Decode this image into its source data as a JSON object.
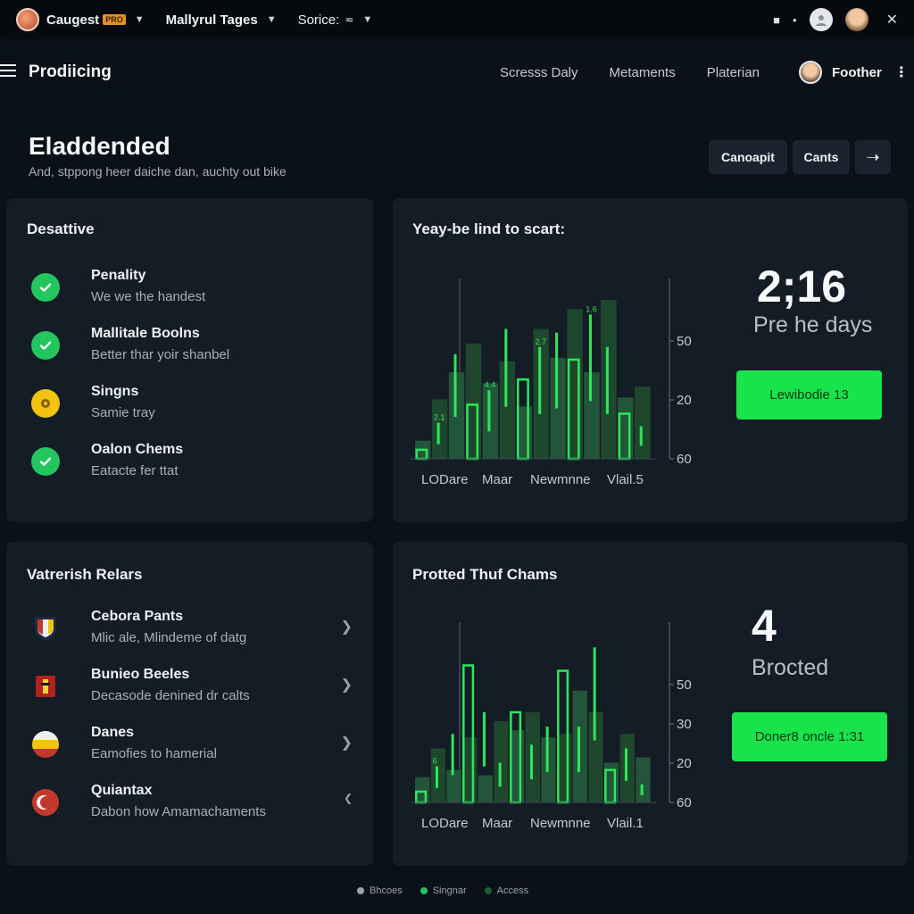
{
  "topbar": {
    "app_name": "Caugest",
    "app_badge": "PRO",
    "menu2": "Mallyrul Tages",
    "menu3": "Sorice:",
    "menu3_value": "≂"
  },
  "nav": {
    "title": "Prodiicing",
    "links": [
      "Scresss Daly",
      "Metaments",
      "Platerian"
    ],
    "user_name": "Foother"
  },
  "header": {
    "title": "Eladdended",
    "subtitle": "And, stppong heer daiche dan, auchty out bike",
    "actions": [
      "Canoapit",
      "Cants"
    ]
  },
  "status_card": {
    "title": "Desattive",
    "items": [
      {
        "title": "Penality",
        "subtitle": "We we the handest",
        "status": "check"
      },
      {
        "title": "Mallitale Boolns",
        "subtitle": "Better thar yoir shanbel",
        "status": "check"
      },
      {
        "title": "Singns",
        "subtitle": "Samie tray",
        "status": "warning"
      },
      {
        "title": "Oalon Chems",
        "subtitle": "Eatacte fer ttat",
        "status": "check"
      }
    ]
  },
  "relations_card": {
    "title": "Vatrerish Relars",
    "items": [
      {
        "title": "Cebora Pants",
        "subtitle": "Mlic ale, Mlindeme of datg",
        "icon": "shield-flag-icon"
      },
      {
        "title": "Bunieo Beeles",
        "subtitle": "Decasode denined dr calts",
        "icon": "red-flag-icon"
      },
      {
        "title": "Danes",
        "subtitle": "Eamofies to hamerial",
        "icon": "flag-circle-icon"
      },
      {
        "title": "Quiantax",
        "subtitle": "Dabon how Amamachaments",
        "icon": "crescent-flag-icon"
      }
    ]
  },
  "chart_cards": [
    {
      "title": "Yeay-be lind to scart:",
      "big_number": "2;16",
      "big_label": "Pre he days",
      "button": "Lewibodie 13",
      "chart_data": {
        "type": "bar",
        "categories": [
          "LODare",
          "Maar",
          "Newmnne",
          "Vlail.5"
        ],
        "yticks": [
          "50",
          "20",
          "60"
        ],
        "data_labels": [
          "2.1",
          "4.4",
          "2.7",
          "1.6"
        ],
        "series": [
          {
            "values": [
              10,
              33,
              48,
              64,
              42,
              54,
              29,
              72,
              56,
              83,
              48,
              88,
              34,
              40
            ]
          },
          {
            "values": [
              5,
              20,
              58,
              30,
              38,
              72,
              44,
              62,
              70,
              55,
              80,
              62,
              25,
              18
            ]
          }
        ]
      }
    },
    {
      "title": "Protted Thuf Chams",
      "big_number": "4",
      "big_label": "Brocted",
      "button": "Doner8 oncle 1:31",
      "chart_data": {
        "type": "bar",
        "categories": [
          "LODare",
          "Maar",
          "Newmnne",
          "Vlail.1"
        ],
        "yticks": [
          "50",
          "30",
          "20",
          "60"
        ],
        "data_labels": [
          "6"
        ],
        "series": [
          {
            "values": [
              14,
              30,
              18,
              36,
              15,
              45,
              40,
              50,
              36,
              38,
              62,
              50,
              22,
              38,
              25
            ]
          },
          {
            "values": [
              6,
              20,
              38,
              76,
              50,
              22,
              50,
              32,
              42,
              73,
              42,
              86,
              18,
              30,
              10
            ]
          }
        ]
      }
    }
  ],
  "legend": [
    "Bhcoes",
    "Singnar",
    "Access"
  ],
  "colors": {
    "background": "#0b1118",
    "card": "#141d26",
    "accent_green": "#19e34a",
    "check_green": "#22c55e",
    "warning_yellow": "#f1c40f"
  }
}
